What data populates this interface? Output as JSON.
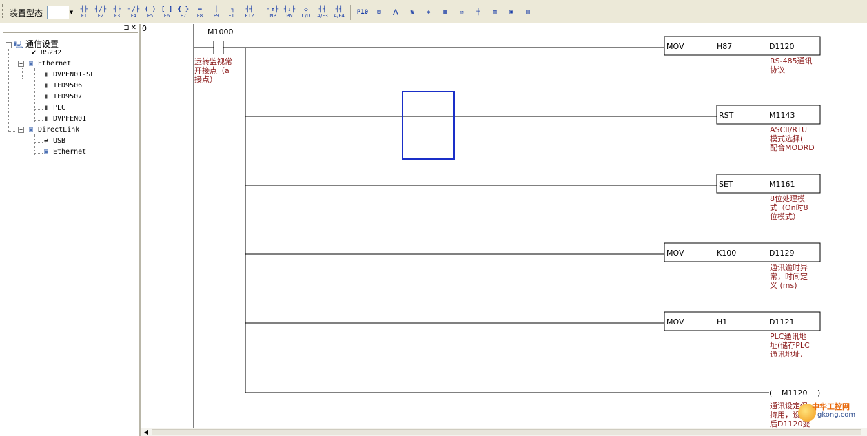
{
  "toolbar": {
    "device_label": "装置型态",
    "device_value": "",
    "buttons": [
      {
        "glyph": "┤├",
        "label": "F1",
        "icon": "contact-no-icon"
      },
      {
        "glyph": "┤/├",
        "label": "F2",
        "icon": "contact-nc-icon"
      },
      {
        "glyph": "┤├",
        "label": "F3",
        "icon": "parallel-no-icon"
      },
      {
        "glyph": "┤/├",
        "label": "F4",
        "icon": "parallel-nc-icon"
      },
      {
        "glyph": "( )",
        "label": "F5",
        "icon": "coil-icon"
      },
      {
        "glyph": "[ ]",
        "label": "F6",
        "icon": "function-icon"
      },
      {
        "glyph": "{ }",
        "label": "F7",
        "icon": "application-icon"
      },
      {
        "glyph": "═",
        "label": "F8",
        "icon": "hline-icon"
      },
      {
        "glyph": "│",
        "label": "F9",
        "icon": "vline-icon"
      },
      {
        "glyph": "┐",
        "label": "F11",
        "icon": "branch-icon"
      },
      {
        "glyph": "┤┤",
        "label": "F12",
        "icon": "reverse-icon"
      },
      {
        "glyph": "┤↑├",
        "label": "NP",
        "icon": "rising-edge-icon"
      },
      {
        "glyph": "┤↓├",
        "label": "PN",
        "icon": "falling-edge-icon"
      },
      {
        "glyph": "◇",
        "label": "C/D",
        "icon": "invert-icon"
      },
      {
        "glyph": "┤┤",
        "label": "A/F3",
        "icon": "af3-icon"
      },
      {
        "glyph": "┤┤",
        "label": "A/F4",
        "icon": "af4-icon"
      },
      {
        "glyph": "P10",
        "label": "",
        "icon": "p10-icon"
      },
      {
        "glyph": "⊞",
        "label": "",
        "icon": "network-icon"
      },
      {
        "glyph": "⋀",
        "label": "",
        "icon": "monitor-icon"
      },
      {
        "glyph": "≶",
        "label": "",
        "icon": "compare-icon"
      },
      {
        "glyph": "◈",
        "label": "",
        "icon": "diamond-icon"
      },
      {
        "glyph": "▦",
        "label": "",
        "icon": "table-icon"
      },
      {
        "glyph": "✉",
        "label": "",
        "icon": "mail-icon"
      },
      {
        "glyph": "╪",
        "label": "",
        "icon": "rung-icon"
      },
      {
        "glyph": "▥",
        "label": "",
        "icon": "column-icon"
      },
      {
        "glyph": "▣",
        "label": "",
        "icon": "grid-icon"
      },
      {
        "glyph": "▤",
        "label": "",
        "icon": "rows-icon"
      }
    ]
  },
  "tree": {
    "root": "通信设置",
    "rs232": "RS232",
    "ethernet": "Ethernet",
    "ethernet_children": [
      "DVPEN01-SL",
      "IFD9506",
      "IFD9507",
      "PLC",
      "DVPFEN01"
    ],
    "directlink": "DirectLink",
    "directlink_children": [
      "USB",
      "Ethernet"
    ]
  },
  "ladder": {
    "line_number": "0",
    "contact": {
      "device": "M1000",
      "comment": [
        "运转监视常",
        "开接点（a",
        "接点）"
      ]
    },
    "rungs": [
      {
        "op": "MOV",
        "a": "H87",
        "b": "D1120",
        "comment": [
          "RS-485通讯",
          "协议"
        ]
      },
      {
        "op": "RST",
        "a": "M1143",
        "comment": [
          "ASCII/RTU",
          "模式选择(",
          "配合MODRD"
        ]
      },
      {
        "op": "SET",
        "a": "M1161",
        "comment": [
          "8位处理模",
          "式（On时8",
          "位模式）"
        ]
      },
      {
        "op": "MOV",
        "a": "K100",
        "b": "D1129",
        "comment": [
          "通讯逾时异",
          "常，时间定",
          "义 (ms)"
        ]
      },
      {
        "op": "MOV",
        "a": "H1",
        "b": "D1121",
        "comment": [
          "PLC通讯地",
          "址(储存PLC",
          "通讯地址,"
        ]
      },
      {
        "op": "coil",
        "a": "M1120",
        "comment": [
          "通讯设定保",
          "持用，设定",
          "后D1120变"
        ]
      }
    ]
  },
  "watermark": {
    "line1": "中华工控网",
    "line2": "gkong.com"
  },
  "colors": {
    "comment": "#8b1a1a",
    "cursor": "#1a2fc8",
    "toolbar_bg": "#ece9d8"
  }
}
